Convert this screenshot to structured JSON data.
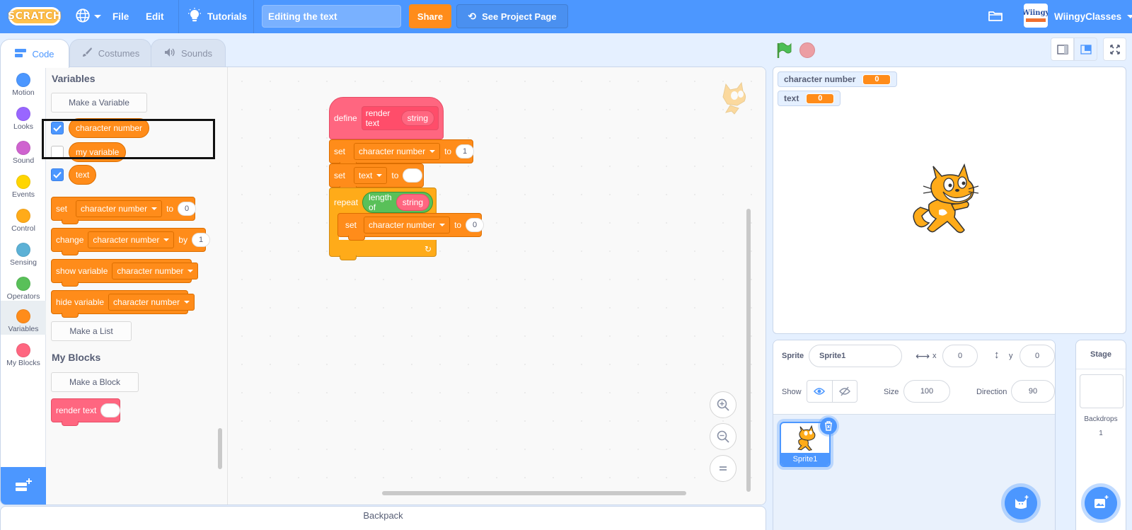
{
  "menubar": {
    "logo": "SCRATCH",
    "language_icon": "globe-icon",
    "file": "File",
    "edit": "Edit",
    "tutorials": "Tutorials",
    "project_title": "Editing the text",
    "share": "Share",
    "see_project_page": "See Project Page",
    "my_stuff_icon": "folder-icon",
    "avatar_text": "Wiingy",
    "username": "WiingyClasses"
  },
  "tabs": [
    {
      "label": "Code",
      "active": true,
      "icon": "code-icon"
    },
    {
      "label": "Costumes",
      "active": false,
      "icon": "brush-icon"
    },
    {
      "label": "Sounds",
      "active": false,
      "icon": "speaker-icon"
    }
  ],
  "categories": [
    {
      "label": "Motion",
      "color": "#4c97ff"
    },
    {
      "label": "Looks",
      "color": "#9966ff"
    },
    {
      "label": "Sound",
      "color": "#cf63cf"
    },
    {
      "label": "Events",
      "color": "#ffd500"
    },
    {
      "label": "Control",
      "color": "#ffab19"
    },
    {
      "label": "Sensing",
      "color": "#5cb1d6"
    },
    {
      "label": "Operators",
      "color": "#59c059"
    },
    {
      "label": "Variables",
      "color": "#ff8c1a",
      "selected": true
    },
    {
      "label": "My Blocks",
      "color": "#ff6680"
    }
  ],
  "palette": {
    "variables_title": "Variables",
    "make_variable": "Make a Variable",
    "variables": [
      {
        "name": "character number",
        "checked": true
      },
      {
        "name": "my variable",
        "checked": false
      },
      {
        "name": "text",
        "checked": true
      }
    ],
    "set_block": {
      "kw": "set",
      "var": "character number",
      "to": "to",
      "value": "0"
    },
    "change_block": {
      "kw": "change",
      "var": "character number",
      "by": "by",
      "value": "1"
    },
    "show_block": {
      "kw": "show variable",
      "var": "character number"
    },
    "hide_block": {
      "kw": "hide variable",
      "var": "character number"
    },
    "make_list": "Make a List",
    "myblocks_title": "My Blocks",
    "make_block": "Make a Block",
    "render_block": "render text"
  },
  "script": {
    "define": {
      "kw": "define",
      "name": "render text",
      "param": "string"
    },
    "set1": {
      "kw": "set",
      "var": "character number",
      "to": "to",
      "value": "1"
    },
    "set2": {
      "kw": "set",
      "var": "text",
      "to": "to",
      "value": ""
    },
    "repeat": {
      "kw": "repeat",
      "op": "length of",
      "param": "string"
    },
    "set3": {
      "kw": "set",
      "var": "character number",
      "to": "to",
      "value": "0"
    },
    "loop_arrow": "↻"
  },
  "zoom_controls": [
    "zoom-in",
    "zoom-out",
    "zoom-reset"
  ],
  "backpack": "Backpack",
  "stage": {
    "monitors": [
      {
        "label": "character number",
        "value": "0"
      },
      {
        "label": "text",
        "value": "0"
      }
    ]
  },
  "sprite_info": {
    "sprite_label": "Sprite",
    "sprite_name": "Sprite1",
    "x_label": "x",
    "x": "0",
    "y_label": "y",
    "y": "0",
    "show_label": "Show",
    "size_label": "Size",
    "size": "100",
    "direction_label": "Direction",
    "direction": "90",
    "visible": true
  },
  "sprites": [
    {
      "name": "Sprite1",
      "selected": true
    }
  ],
  "stage_panel": {
    "title": "Stage",
    "backdrops_label": "Backdrops",
    "backdrops_count": "1"
  }
}
